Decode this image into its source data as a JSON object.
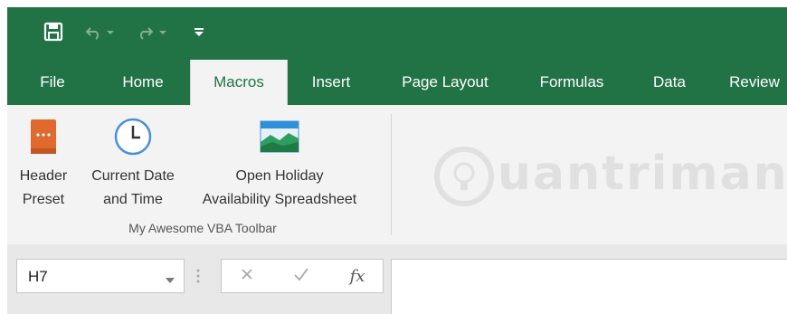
{
  "quick_access": {
    "save_icon": "save-icon",
    "undo_icon": "undo-icon",
    "redo_icon": "redo-icon",
    "customize_icon": "customize-quick-access-icon"
  },
  "tabs": [
    {
      "label": "File"
    },
    {
      "label": "Home"
    },
    {
      "label": "Macros",
      "active": true
    },
    {
      "label": "Insert"
    },
    {
      "label": "Page Layout"
    },
    {
      "label": "Formulas"
    },
    {
      "label": "Data"
    },
    {
      "label": "Review"
    }
  ],
  "ribbon": {
    "group_label": "My Awesome VBA Toolbar",
    "buttons": [
      {
        "line1": "Header",
        "line2": "Preset",
        "icon": "book-icon"
      },
      {
        "line1": "Current Date",
        "line2": "and Time",
        "icon": "clock-icon"
      },
      {
        "line1": "Open Holiday",
        "line2": "Availability Spreadsheet",
        "icon": "landscape-image-icon"
      }
    ]
  },
  "watermark": {
    "text": "uantrimang"
  },
  "formula_bar": {
    "name_box": "H7",
    "cancel_icon": "cancel-icon",
    "enter_icon": "enter-icon",
    "fx_label": "fx",
    "formula_value": ""
  },
  "colors": {
    "excel_green": "#217346",
    "ribbon_bg": "#f3f3f3",
    "formula_area_bg": "#e8e8e8",
    "book_orange": "#e0692e",
    "clock_blue": "#4a90d9"
  }
}
